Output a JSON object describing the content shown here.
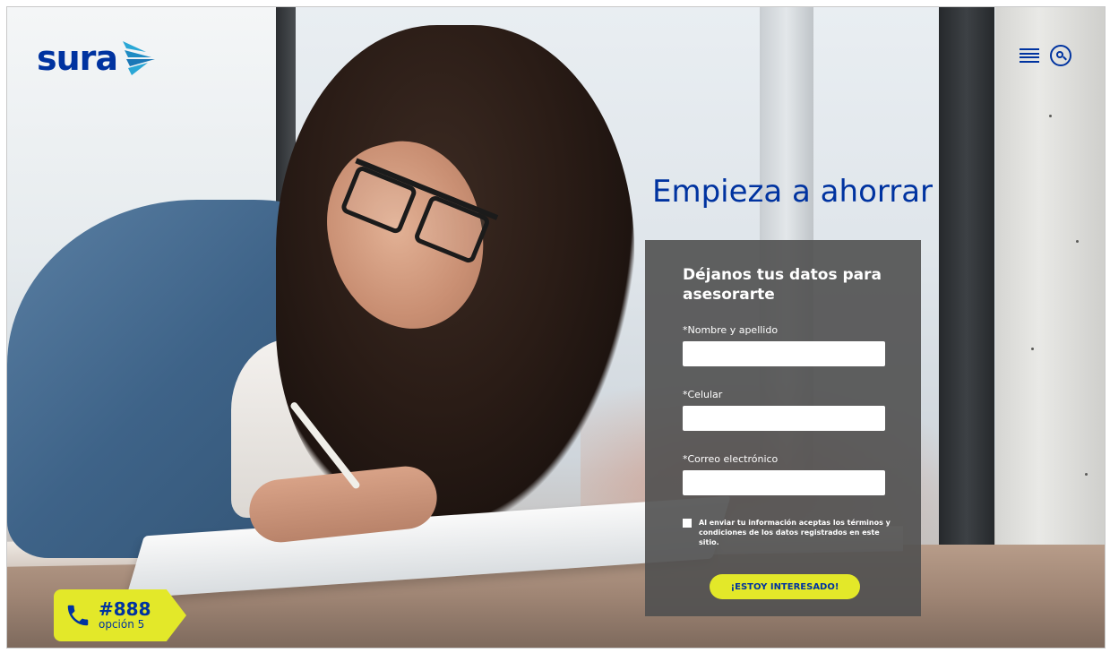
{
  "brand": {
    "logo_text": "sura",
    "primary_color": "#0033a0",
    "accent_color": "#e3e829"
  },
  "header": {
    "menu_icon": "hamburger-icon",
    "search_icon": "search-icon"
  },
  "hero": {
    "headline": "Empieza a ahorrar"
  },
  "form": {
    "title": "Déjanos tus datos para asesorarte",
    "fields": [
      {
        "label": "*Nombre y apellido",
        "value": "",
        "placeholder": ""
      },
      {
        "label": "*Celular",
        "value": "",
        "placeholder": ""
      },
      {
        "label": "*Correo electrónico",
        "value": "",
        "placeholder": ""
      }
    ],
    "terms_text": "Al enviar tu información aceptas los términos y condiciones de los datos registrados en este sitio.",
    "submit_label": "¡ESTOY INTERESADO!"
  },
  "phone_badge": {
    "icon": "phone-icon",
    "number": "#888",
    "option": "opción 5"
  }
}
